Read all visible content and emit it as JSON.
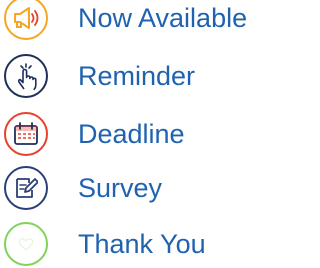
{
  "legend": {
    "items": [
      {
        "label": "Now Available",
        "icon": "megaphone-icon",
        "color": "#f5a623"
      },
      {
        "label": "Reminder",
        "icon": "tap-hand-icon",
        "color": "#1e2f5c"
      },
      {
        "label": "Deadline",
        "icon": "calendar-icon",
        "color": "#e8412c"
      },
      {
        "label": "Survey",
        "icon": "edit-document-icon",
        "color": "#2a3f78"
      },
      {
        "label": "Thank You",
        "icon": "thank-you-icon",
        "color": "#7fd35a"
      }
    ]
  }
}
